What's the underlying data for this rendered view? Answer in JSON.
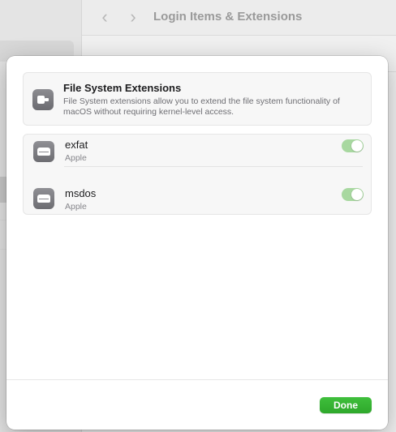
{
  "background_window": {
    "title": "Login Items & Extensions",
    "back_glyph": "‹",
    "forward_glyph": "›"
  },
  "sheet": {
    "header": {
      "icon": "puzzle-extension-icon",
      "title": "File System Extensions",
      "description": "File System extensions allow you to extend the file system functionality of macOS without requiring kernel-level access."
    },
    "extensions": [
      {
        "name": "exfat",
        "vendor": "Apple",
        "icon": "disk-drive-icon",
        "enabled": true
      },
      {
        "name": "msdos",
        "vendor": "Apple",
        "icon": "disk-drive-icon",
        "enabled": true
      }
    ],
    "done_label": "Done"
  },
  "colors": {
    "accent_green": "#34b033",
    "toggle_on": "#a8d8a0"
  }
}
